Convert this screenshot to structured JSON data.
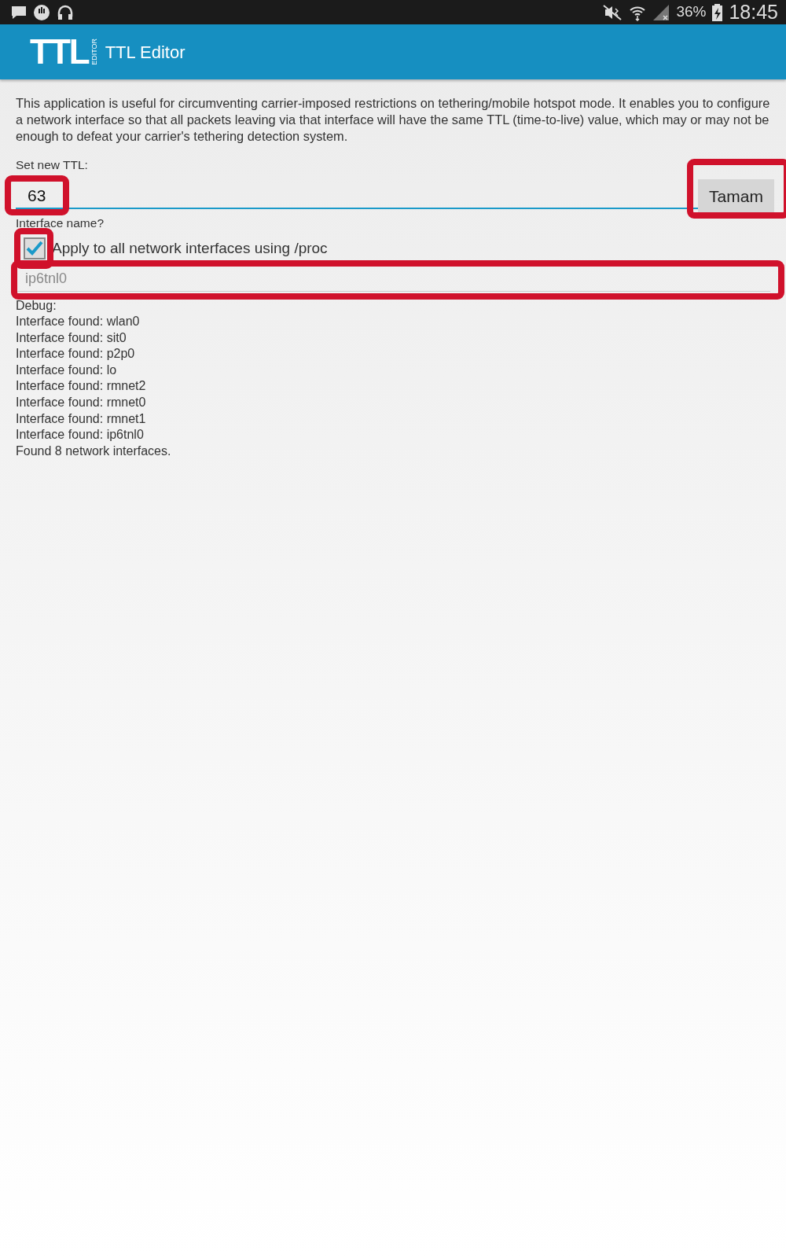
{
  "status_bar": {
    "battery": "36%",
    "time": "18:45"
  },
  "app_bar": {
    "logo_text": "TTL",
    "logo_side_text": "EDITOR",
    "title": "TTL Editor"
  },
  "description": "This application is useful for circumventing carrier-imposed restrictions on tethering/mobile hotspot mode. It enables you to configure a network interface so that all packets leaving via that interface will have the same TTL (time-to-live) value, which may or may not be enough to defeat your carrier's tethering detection system.",
  "ttl": {
    "label": "Set new TTL:",
    "value": "63",
    "highlighted": true
  },
  "ok_button": {
    "label": "Tamam",
    "highlighted": true
  },
  "interface": {
    "label": "Interface name?",
    "apply_all": {
      "label": "Apply to all network interfaces using /proc",
      "checked": true,
      "highlighted": true
    },
    "field": {
      "value": "ip6tnl0",
      "disabled": true,
      "highlighted": true
    }
  },
  "debug": {
    "lines": [
      "Debug:",
      "Interface found: wlan0",
      "Interface found: sit0",
      "Interface found: p2p0",
      "Interface found: lo",
      "Interface found: rmnet2",
      "Interface found: rmnet0",
      "Interface found: rmnet1",
      "Interface found: ip6tnl0",
      "Found 8 network interfaces."
    ]
  }
}
